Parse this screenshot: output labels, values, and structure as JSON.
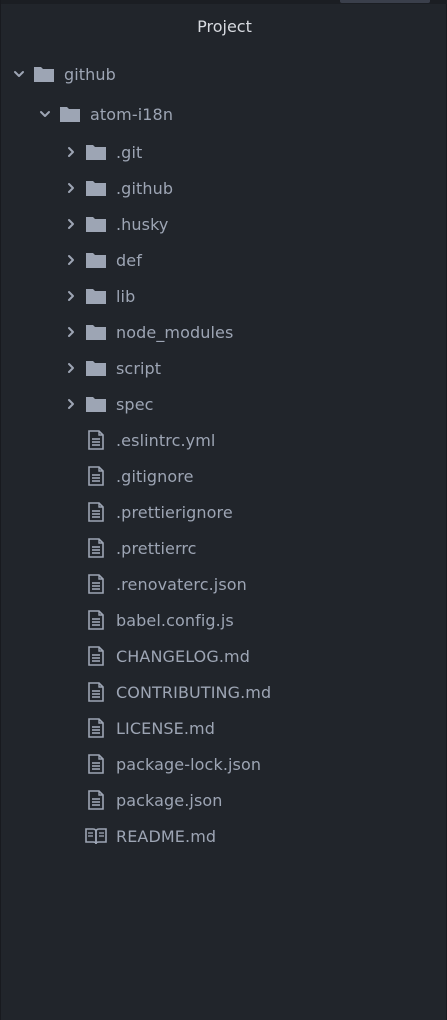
{
  "panel": {
    "title": "Project"
  },
  "tree": {
    "root": {
      "label": "github",
      "icon": "folder-icon",
      "expanded": true
    },
    "repo": {
      "label": "atom-i18n",
      "icon": "folder-icon",
      "expanded": true
    },
    "folders": [
      {
        "label": ".git"
      },
      {
        "label": ".github"
      },
      {
        "label": ".husky"
      },
      {
        "label": "def"
      },
      {
        "label": "lib"
      },
      {
        "label": "node_modules"
      },
      {
        "label": "script"
      },
      {
        "label": "spec"
      }
    ],
    "files": [
      {
        "label": ".eslintrc.yml",
        "icon": "file-text-icon"
      },
      {
        "label": ".gitignore",
        "icon": "file-text-icon"
      },
      {
        "label": ".prettierignore",
        "icon": "file-text-icon"
      },
      {
        "label": ".prettierrc",
        "icon": "file-text-icon"
      },
      {
        "label": ".renovaterc.json",
        "icon": "file-text-icon"
      },
      {
        "label": "babel.config.js",
        "icon": "file-text-icon"
      },
      {
        "label": "CHANGELOG.md",
        "icon": "file-text-icon"
      },
      {
        "label": "CONTRIBUTING.md",
        "icon": "file-text-icon"
      },
      {
        "label": "LICENSE.md",
        "icon": "file-text-icon"
      },
      {
        "label": "package-lock.json",
        "icon": "file-text-icon"
      },
      {
        "label": "package.json",
        "icon": "file-text-icon"
      },
      {
        "label": "README.md",
        "icon": "book-icon"
      }
    ]
  },
  "colors": {
    "background": "#21252b",
    "text": "#9da5b4",
    "title": "#d7dae0",
    "icon": "#9da5b4"
  }
}
